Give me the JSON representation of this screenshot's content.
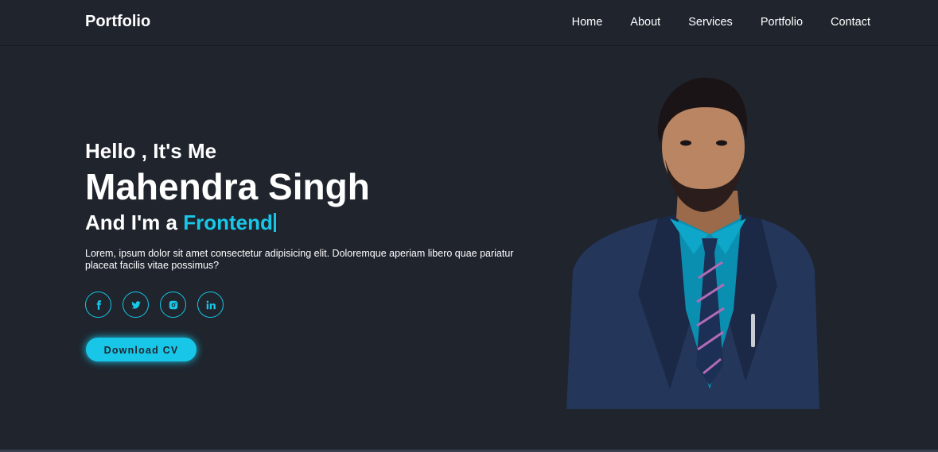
{
  "header": {
    "logo": "Portfolio",
    "nav": [
      "Home",
      "About",
      "Services",
      "Portfolio",
      "Contact"
    ]
  },
  "hero": {
    "greeting": "Hello , It's Me",
    "name": "Mahendra Singh",
    "role_prefix": "And I'm a",
    "role_highlight": "Frontend",
    "description": "Lorem, ipsum dolor sit amet consectetur adipisicing elit. Doloremque aperiam libero quae pariatur placeat facilis vitae possimus?",
    "social": [
      {
        "icon": "facebook-icon",
        "glyph": "f"
      },
      {
        "icon": "twitter-icon",
        "glyph": "t"
      },
      {
        "icon": "instagram-icon",
        "glyph": "◎"
      },
      {
        "icon": "linkedin-icon",
        "glyph": "in"
      }
    ],
    "cta": "Download CV"
  },
  "colors": {
    "background": "#1f242d",
    "accent": "#18c7e8",
    "text": "#ffffff"
  }
}
